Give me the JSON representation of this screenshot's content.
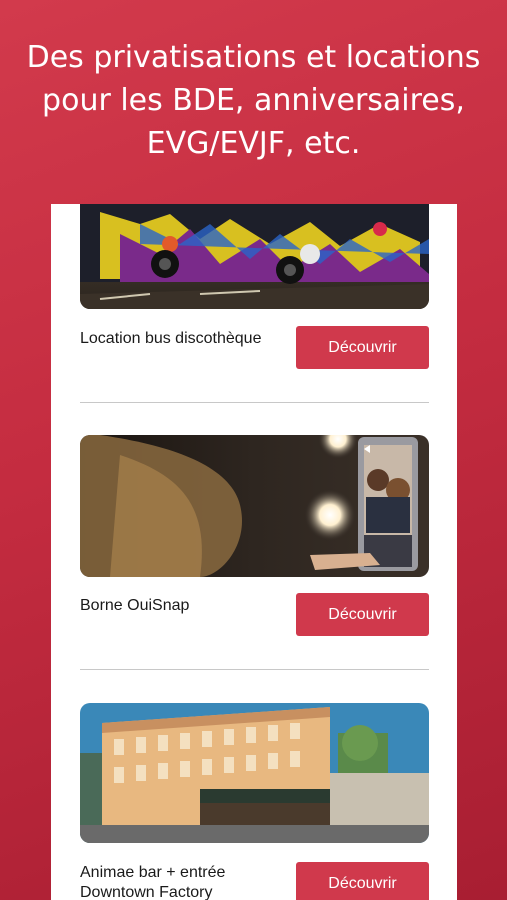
{
  "header": {
    "line1": "Des privatisations et locations",
    "line2": "pour les BDE, anniversaires,",
    "line3": "EVG/EVJF, etc."
  },
  "items": [
    {
      "title": "Location bus discothèque",
      "button": "Découvrir",
      "image": "party-bus-photo"
    },
    {
      "title": "Borne OuiSnap",
      "button": "Découvrir",
      "image": "photo-booth-photo"
    },
    {
      "title_line1": "Animae bar + entrée",
      "title_line2": "Downtown Factory",
      "button": "Découvrir",
      "image": "bar-building-photo"
    }
  ],
  "colors": {
    "background": "#c42c40",
    "button": "#d0394c",
    "card": "#ffffff"
  }
}
